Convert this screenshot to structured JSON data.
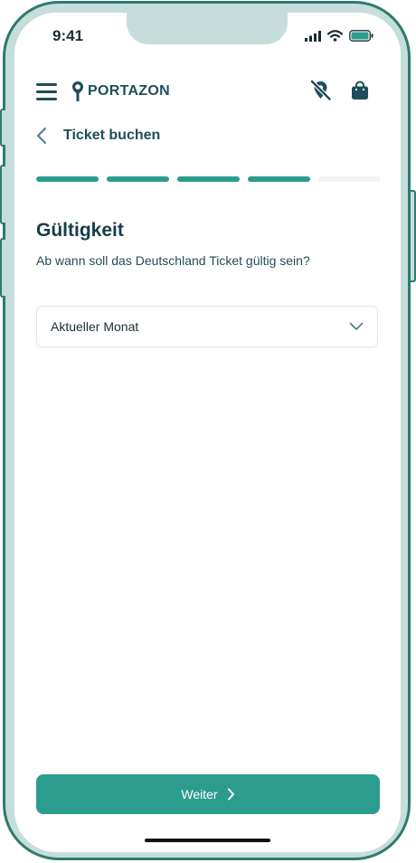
{
  "status_bar": {
    "time": "9:41"
  },
  "header": {
    "brand": "PORTAZON"
  },
  "nav": {
    "title": "Ticket buchen"
  },
  "progress": {
    "total_steps": 5,
    "completed_steps": 4
  },
  "content": {
    "heading": "Gültigkeit",
    "question": "Ab wann soll das Deutschland Ticket gültig sein?",
    "select": {
      "value": "Aktueller Monat"
    }
  },
  "footer": {
    "next_label": "Weiter"
  },
  "colors": {
    "accent": "#2c9c8f",
    "brand": "#1f4d5c",
    "frame": "#2e7a6e"
  }
}
